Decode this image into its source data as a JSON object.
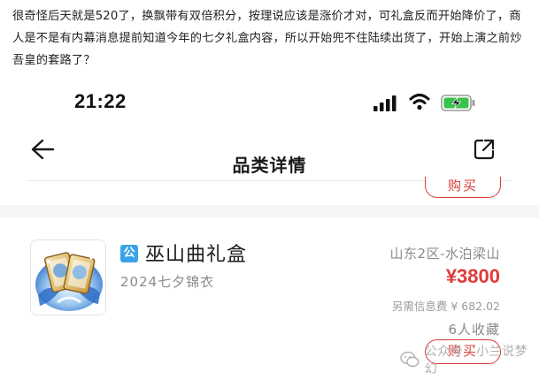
{
  "article": {
    "intro_text": "很奇怪后天就是520了，换飘带有双倍积分，按理说应该是涨价才对，可礼盒反而开始降价了，商人是不是有内幕消息提前知道今年的七夕礼盒内容，所以开始兜不住陆续出货了，开始上演之前炒吾皇的套路了？"
  },
  "status_bar": {
    "time": "21:22",
    "icons": [
      "signal-icon",
      "wifi-icon",
      "battery-charging-icon"
    ],
    "battery_color": "#37c24b"
  },
  "nav": {
    "title": "品类详情",
    "back_icon": "back-arrow-icon",
    "share_icon": "share-icon"
  },
  "buy_label": "购买",
  "item": {
    "badge": "公",
    "name": "巫山曲礼盒",
    "subtitle": "2024七夕锦衣",
    "server": "山东2区-水泊梁山",
    "price": "¥3800",
    "fee": "另需信息费 ¥ 682.02",
    "favorites": "6人收藏"
  },
  "watermark": {
    "text": "公众号 · 小兰说梦幻",
    "icon": "wechat-icon"
  },
  "colors": {
    "accent_red": "#e03a3a",
    "badge_blue": "#3aa3e8",
    "muted_gray": "#8a8a8a"
  }
}
